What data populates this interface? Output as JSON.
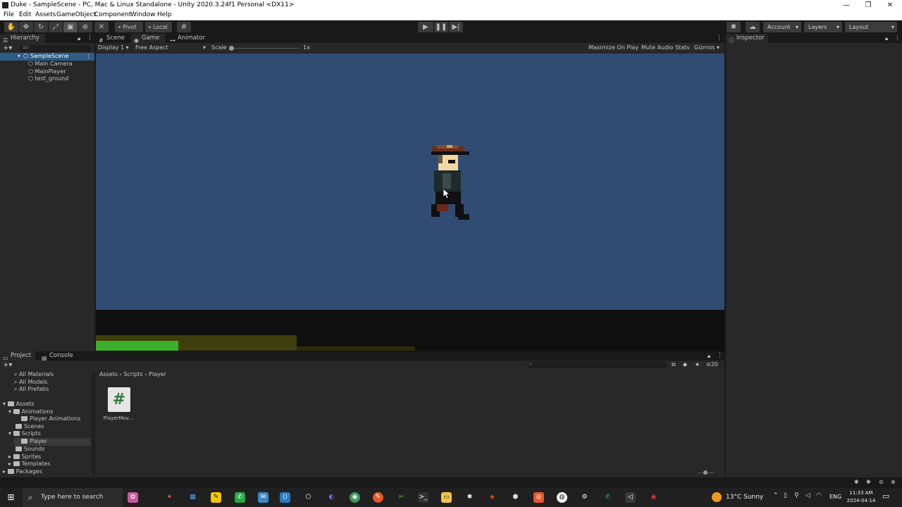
{
  "window": {
    "title": "Duke - SampleScene - PC, Mac & Linux Standalone - Unity 2020.3.24f1 Personal <DX11>",
    "controls": {
      "minimize": "—",
      "restore": "❐",
      "close": "✕"
    }
  },
  "menubar": {
    "items": [
      "File",
      "Edit",
      "Assets",
      "GameObject",
      "Component",
      "Window",
      "Help"
    ]
  },
  "toolbar": {
    "pivot_label": "Pivot",
    "local_label": "Local",
    "play_icon": "play-icon",
    "pause_icon": "pause-icon",
    "step_icon": "step-icon",
    "account_label": "Account",
    "layers_label": "Layers",
    "layout_label": "Layout"
  },
  "hierarchy": {
    "tab_label": "Hierarchy",
    "search_placeholder": "All",
    "scene_name": "SampleScene",
    "objects": [
      "Main Camera",
      "MainPlayer",
      "test_ground"
    ]
  },
  "center_tabs": [
    "Scene",
    "Game",
    "Animator"
  ],
  "game_toolbar": {
    "display": "Display 1",
    "aspect": "Free Aspect",
    "scale_label": "Scale",
    "scale_value": "1x",
    "maximize_on_play": "Maximize On Play",
    "mute_audio": "Mute Audio",
    "stats": "Stats",
    "gizmos": "Gizmos"
  },
  "inspector": {
    "tab_label": "Inspector"
  },
  "bottom_tabs": [
    "Project",
    "Console"
  ],
  "project": {
    "favorites": [
      "All Materials",
      "All Models",
      "All Prefabs"
    ],
    "assets_root": "Assets",
    "tree": [
      {
        "label": "Animations",
        "indent": 1
      },
      {
        "label": "Player Animations",
        "indent": 2
      },
      {
        "label": "Scenes",
        "indent": 1
      },
      {
        "label": "Scripts",
        "indent": 1
      },
      {
        "label": "Player",
        "indent": 2
      },
      {
        "label": "Sounds",
        "indent": 1
      },
      {
        "label": "Sprites",
        "indent": 1
      },
      {
        "label": "Templates",
        "indent": 1
      }
    ],
    "packages_label": "Packages",
    "breadcrumb": [
      "Assets",
      "Scripts",
      "Player"
    ],
    "files": [
      {
        "name": "PlayerMov...",
        "icon": "#"
      }
    ],
    "hidden_count": "20"
  },
  "taskbar": {
    "search_placeholder": "Type here to search",
    "weather": "13°C  Sunny",
    "language": "ENG",
    "time": "11:33 AM",
    "date": "2024-04-14"
  }
}
